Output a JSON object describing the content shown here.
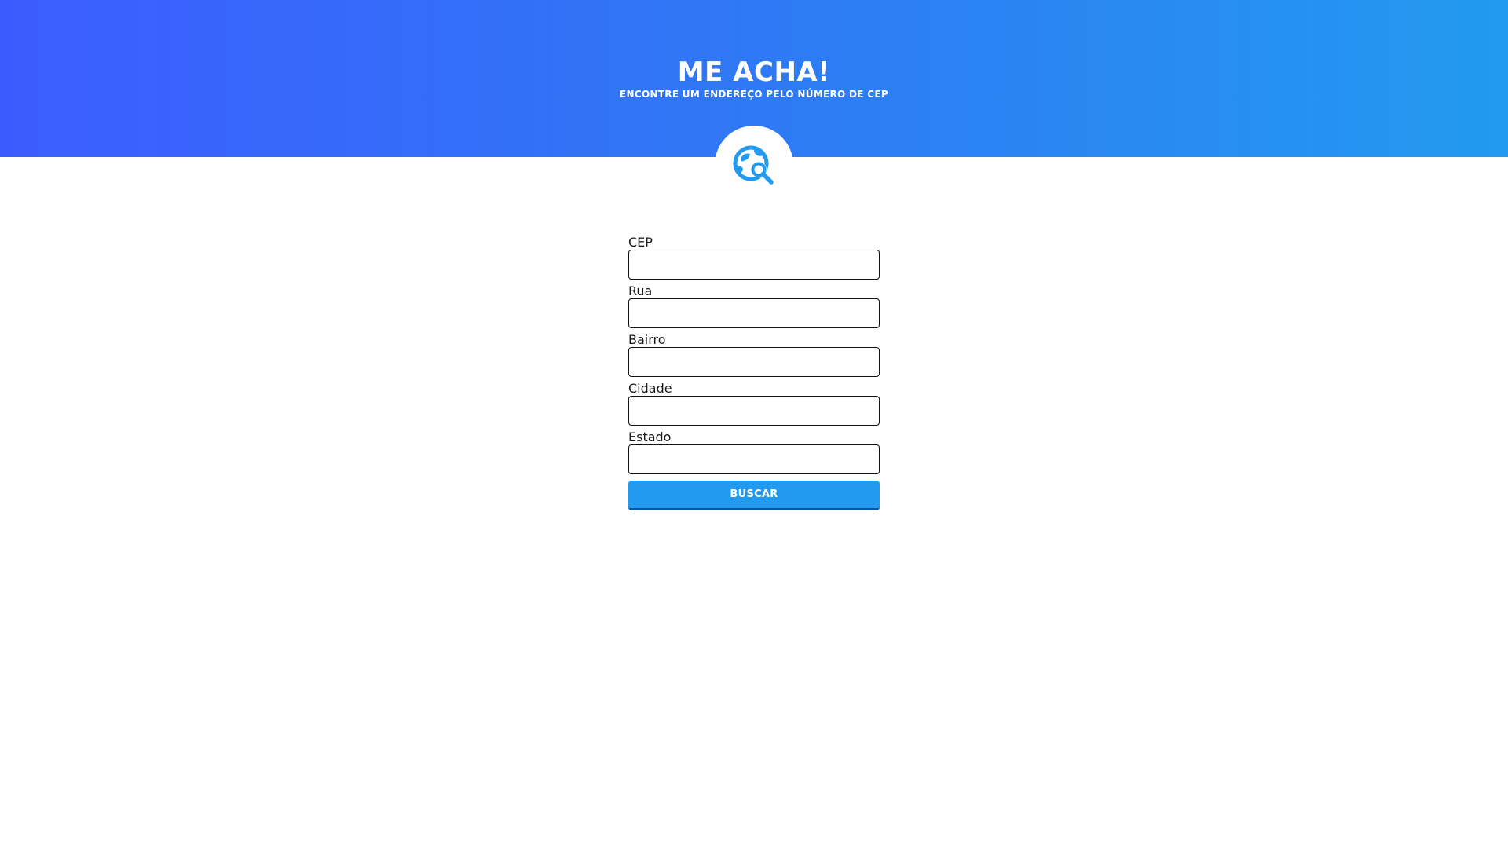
{
  "header": {
    "title": "ME ACHA!",
    "subtitle": "ENCONTRE UM ENDEREÇO PELO NÚMERO DE CEP",
    "gradient_start": "#3c5cff",
    "gradient_end": "#229af0"
  },
  "logo": {
    "icon": "globe-search-icon",
    "color": "#229af0"
  },
  "form": {
    "fields": [
      {
        "label": "CEP",
        "value": "",
        "placeholder": ""
      },
      {
        "label": "Rua",
        "value": "",
        "placeholder": ""
      },
      {
        "label": "Bairro",
        "value": "",
        "placeholder": ""
      },
      {
        "label": "Cidade",
        "value": "",
        "placeholder": ""
      },
      {
        "label": "Estado",
        "value": "",
        "placeholder": ""
      }
    ],
    "submit_label": "BUSCAR",
    "accent_color": "#229af0"
  }
}
